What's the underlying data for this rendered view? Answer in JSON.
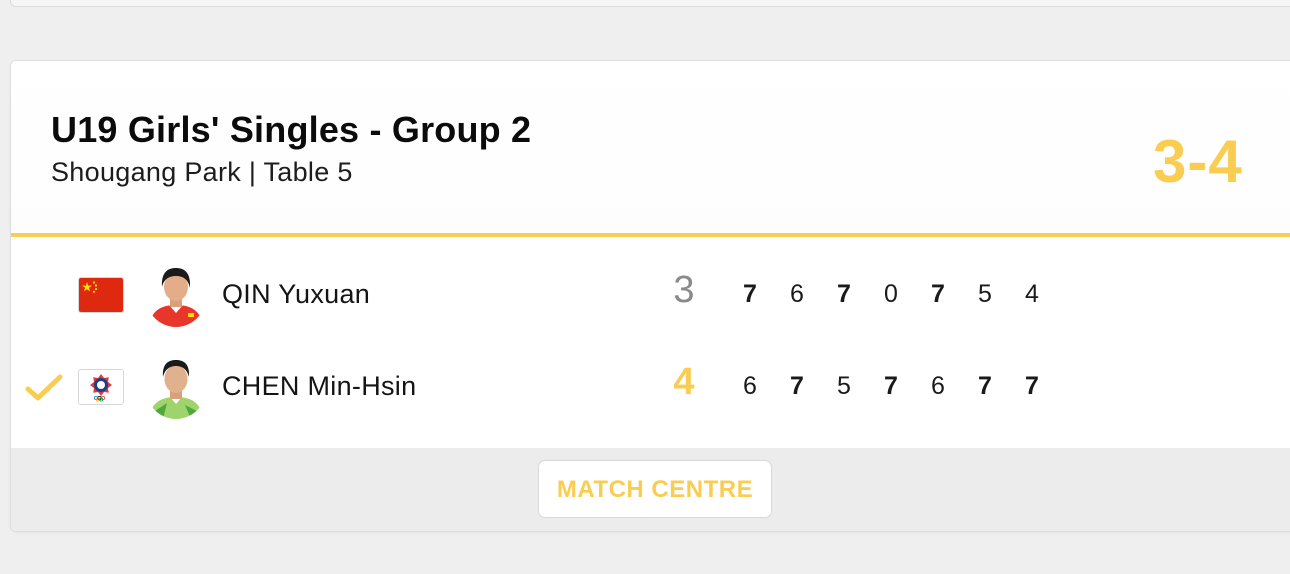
{
  "match": {
    "title": "U19 Girls' Singles - Group 2",
    "subtitle": "Shougang Park | Table 5",
    "overall_score": "3-4"
  },
  "players": [
    {
      "flag": "china-flag",
      "name": "QIN Yuxuan",
      "games_won": "3",
      "winner": false,
      "set_scores": [
        "7",
        "6",
        "7",
        "0",
        "7",
        "5",
        "4"
      ],
      "set_won": [
        true,
        false,
        true,
        false,
        true,
        false,
        false
      ]
    },
    {
      "flag": "chinese-taipei-olympic-flag",
      "name": "CHEN Min-Hsin",
      "games_won": "4",
      "winner": true,
      "set_scores": [
        "6",
        "7",
        "5",
        "7",
        "6",
        "7",
        "7"
      ],
      "set_won": [
        false,
        true,
        false,
        true,
        false,
        true,
        true
      ]
    }
  ],
  "footer": {
    "match_centre_label": "MATCH CENTRE"
  },
  "colors": {
    "accent": "#f9cd52",
    "loser_games": "#8a8a8a",
    "text": "#141414"
  }
}
